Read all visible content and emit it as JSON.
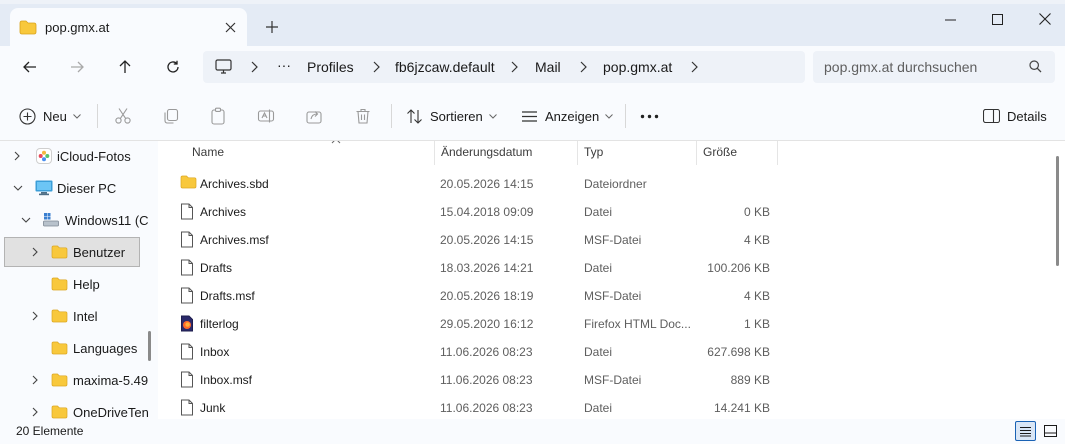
{
  "window": {
    "tab_title": "pop.gmx.at",
    "new_tab_symbol": "+"
  },
  "address": {
    "overflow_symbol": "···",
    "crumbs": [
      "Profiles",
      "fb6jzcaw.default",
      "Mail",
      "pop.gmx.at"
    ]
  },
  "search": {
    "placeholder": "pop.gmx.at durchsuchen"
  },
  "toolbar": {
    "new_label": "Neu",
    "sort_label": "Sortieren",
    "view_label": "Anzeigen",
    "more_symbol": "···",
    "details_label": "Details"
  },
  "nav": {
    "items": [
      {
        "label": "iCloud-Fotos",
        "icon": "icloud-photos-icon"
      },
      {
        "label": "Dieser PC",
        "icon": "computer-icon"
      },
      {
        "label": "Windows11 (C",
        "icon": "drive-icon"
      },
      {
        "label": "Benutzer",
        "icon": "folder-icon"
      },
      {
        "label": "Help",
        "icon": "folder-icon"
      },
      {
        "label": "Intel",
        "icon": "folder-icon"
      },
      {
        "label": "Languages",
        "icon": "folder-icon"
      },
      {
        "label": "maxima-5.49",
        "icon": "folder-icon"
      },
      {
        "label": "OneDriveTen",
        "icon": "folder-icon"
      }
    ]
  },
  "files": {
    "columns": {
      "name": "Name",
      "date": "Änderungsdatum",
      "type": "Typ",
      "size": "Größe"
    },
    "rows": [
      {
        "name": "Archives.sbd",
        "date": "20.05.2026 14:15",
        "type": "Dateiordner",
        "size": "",
        "icon": "folder-icon"
      },
      {
        "name": "Archives",
        "date": "15.04.2018 09:09",
        "type": "Datei",
        "size": "0 KB",
        "icon": "file-icon"
      },
      {
        "name": "Archives.msf",
        "date": "20.05.2026 14:15",
        "type": "MSF-Datei",
        "size": "4 KB",
        "icon": "file-icon"
      },
      {
        "name": "Drafts",
        "date": "18.03.2026 14:21",
        "type": "Datei",
        "size": "100.206 KB",
        "icon": "file-icon"
      },
      {
        "name": "Drafts.msf",
        "date": "20.05.2026 18:19",
        "type": "MSF-Datei",
        "size": "4 KB",
        "icon": "file-icon"
      },
      {
        "name": "filterlog",
        "date": "29.05.2020 16:12",
        "type": "Firefox HTML Doc...",
        "size": "1 KB",
        "icon": "firefox-html-icon"
      },
      {
        "name": "Inbox",
        "date": "11.06.2026 08:23",
        "type": "Datei",
        "size": "627.698 KB",
        "icon": "file-icon"
      },
      {
        "name": "Inbox.msf",
        "date": "11.06.2026 08:23",
        "type": "MSF-Datei",
        "size": "889 KB",
        "icon": "file-icon"
      },
      {
        "name": "Junk",
        "date": "11.06.2026 08:23",
        "type": "Datei",
        "size": "14.241 KB",
        "icon": "file-icon"
      }
    ]
  },
  "status": {
    "item_count": "20 Elemente"
  },
  "colors": {
    "folder": "#f8c83c",
    "accent": "#1a62b4",
    "selected_bg": "#e1e1e1"
  }
}
